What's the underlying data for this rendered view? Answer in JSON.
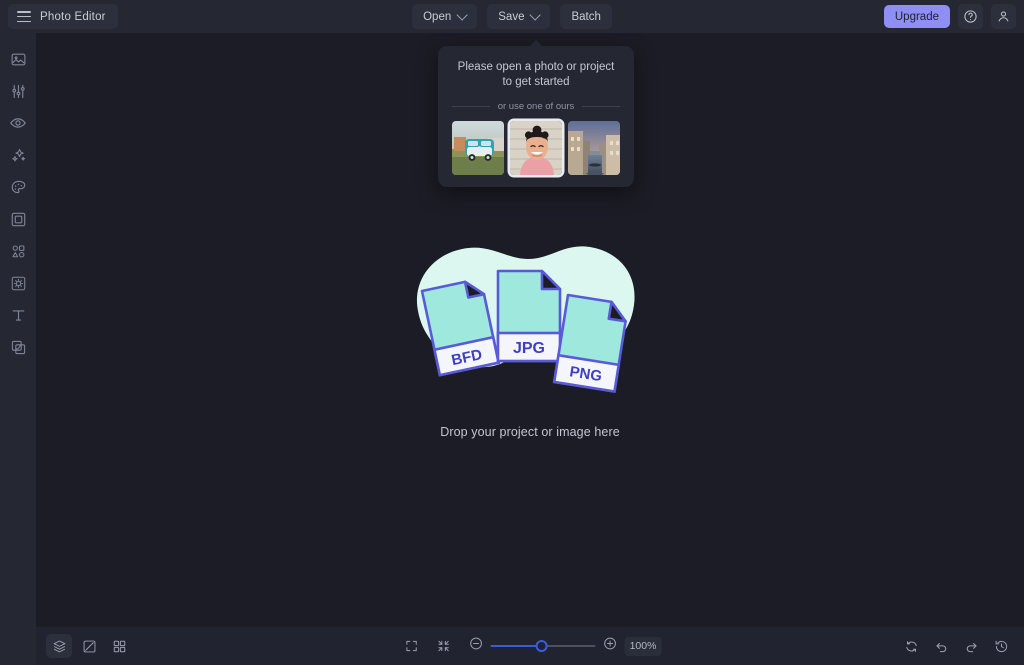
{
  "app": {
    "title": "Photo Editor",
    "menu_icon": "hamburger-icon",
    "bg_color": "#1c1c26",
    "bar_color": "#252833",
    "accent_upgrade": "#8e8ef5",
    "accent_slider": "#3b5bdb"
  },
  "toolbar": {
    "open_label": "Open",
    "save_label": "Save",
    "batch_label": "Batch",
    "upgrade_label": "Upgrade",
    "help_icon": "question-circle-icon",
    "account_icon": "user-icon"
  },
  "sidebar": {
    "items": [
      {
        "name": "image",
        "icon": "image-icon"
      },
      {
        "name": "adjust",
        "icon": "sliders-icon"
      },
      {
        "name": "retouch",
        "icon": "eye-icon"
      },
      {
        "name": "effects",
        "icon": "sparkles-icon"
      },
      {
        "name": "color",
        "icon": "palette-icon"
      },
      {
        "name": "frame",
        "icon": "frame-icon"
      },
      {
        "name": "shapes",
        "icon": "shapes-icon"
      },
      {
        "name": "stickers",
        "icon": "sticker-icon"
      },
      {
        "name": "text",
        "icon": "text-icon"
      },
      {
        "name": "layers",
        "icon": "layers-copy-icon"
      }
    ]
  },
  "popover": {
    "title": "Please open a photo or project to get started",
    "divider_label": "or use one of ours",
    "thumbnails": [
      {
        "name": "vw-bus-photo",
        "alt": "Teal vintage VW van on grass",
        "selected": false
      },
      {
        "name": "portrait-photo",
        "alt": "Smiling woman in pink top",
        "selected": true
      },
      {
        "name": "canal-photo",
        "alt": "European canal street at dusk",
        "selected": false
      }
    ]
  },
  "dropzone": {
    "text": "Drop your project or image here",
    "blob_color": "#dcf7f0",
    "file_fill": "#9fe8dd",
    "file_stroke": "#5a5ad6",
    "files": [
      {
        "label": "BFD"
      },
      {
        "label": "JPG"
      },
      {
        "label": "PNG"
      }
    ]
  },
  "bottombar": {
    "left_tools": [
      {
        "name": "layers-panel",
        "icon": "stack-icon",
        "active": true
      },
      {
        "name": "compare-view",
        "icon": "compare-icon",
        "active": false
      },
      {
        "name": "grid-view",
        "icon": "grid-icon",
        "active": false
      }
    ],
    "view_tools": [
      {
        "name": "fit-screen",
        "icon": "expand-corners-icon"
      },
      {
        "name": "actual-size",
        "icon": "collapse-corners-icon"
      }
    ],
    "zoom_out_icon": "minus-circle-icon",
    "zoom_in_icon": "plus-circle-icon",
    "zoom_value": "100%",
    "zoom_percent": 50,
    "right_tools": [
      {
        "name": "reset",
        "icon": "reset-icon"
      },
      {
        "name": "undo",
        "icon": "undo-icon"
      },
      {
        "name": "redo",
        "icon": "redo-icon"
      },
      {
        "name": "history",
        "icon": "history-icon"
      }
    ]
  }
}
